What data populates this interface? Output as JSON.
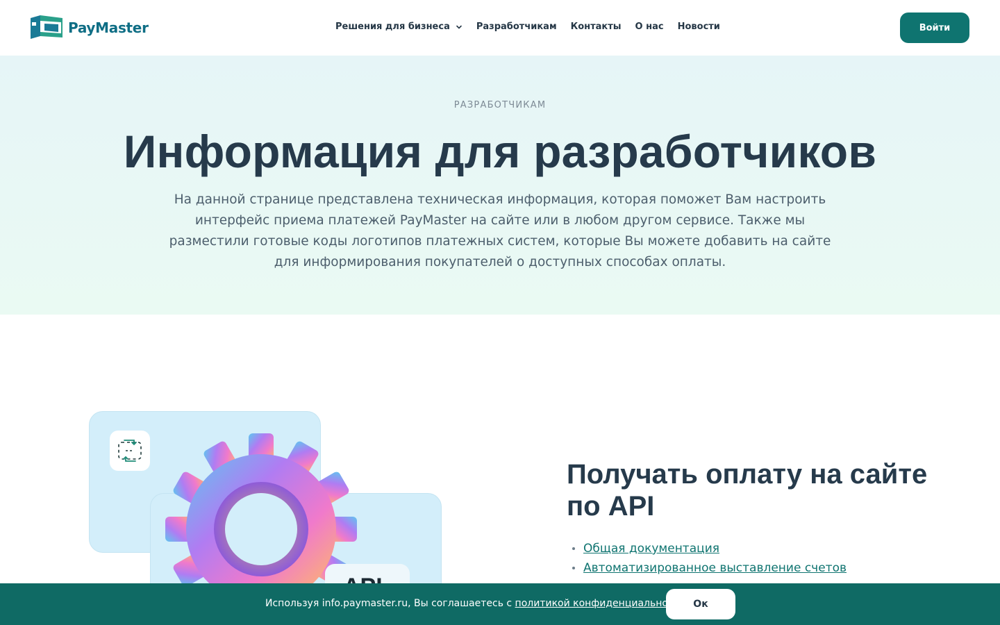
{
  "header": {
    "logo_text": "PayMaster",
    "nav": [
      {
        "label": "Решения для бизнеса",
        "has_dropdown": true
      },
      {
        "label": "Разработчикам"
      },
      {
        "label": "Контакты"
      },
      {
        "label": "О нас"
      },
      {
        "label": "Новости"
      }
    ],
    "login_label": "Войти"
  },
  "hero": {
    "eyebrow": "РАЗРАБОТЧИКАМ",
    "title": "Информация для разработчиков",
    "description": "На данной странице представлена техническая информация, которая поможет Вам настроить интерфейс приема платежей PayMaster на сайте или в любом другом сервисе. Также мы разместили готовые коды логотипов платежных систем, которые Вы можете добавить на сайте для информирования покупателей о доступных способах оплаты."
  },
  "api_section": {
    "title": "Получать оплату на сайте по API",
    "badge": "API",
    "links": [
      {
        "label": "Общая документация"
      },
      {
        "label": "Автоматизированное выставление счетов"
      }
    ]
  },
  "cookie_bar": {
    "text": "Используя info.paymaster.ru, Вы соглашаетесь с ",
    "policy_link": "политикой конфиденциальности",
    "ok_label": "Ок"
  },
  "colors": {
    "brand": "#0f7470",
    "logo": "#0f6e85",
    "heading": "#263a4b",
    "cookie_bg": "#0f6a64"
  },
  "icons": {
    "logo": "paymaster-logo-icon",
    "dropdown": "chevron-down-icon",
    "api": "api-exchange-icon",
    "illustration": "gear-illustration"
  }
}
